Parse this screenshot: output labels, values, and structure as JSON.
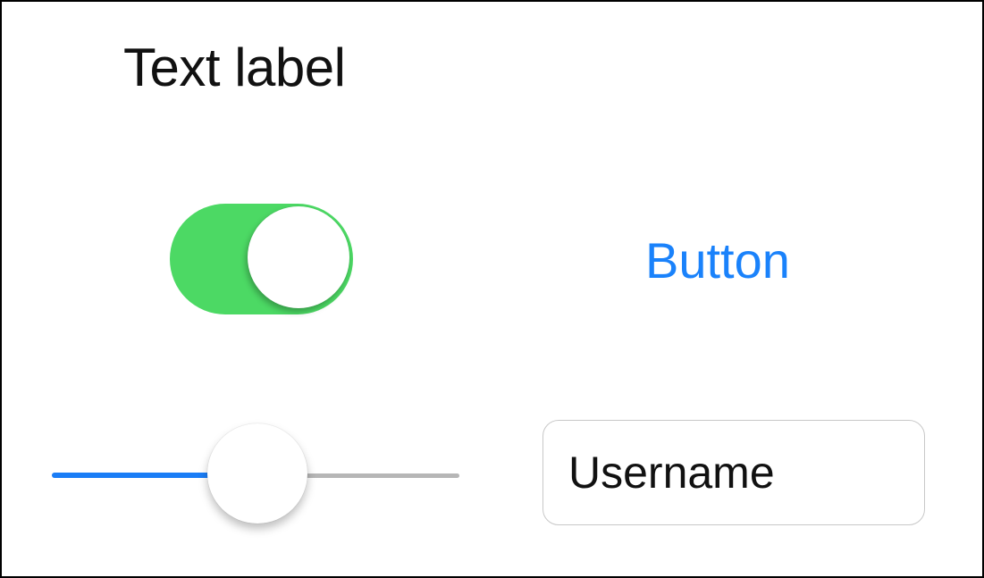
{
  "label": {
    "text": "Text label"
  },
  "toggle": {
    "state": "on",
    "on_color": "#4cd964"
  },
  "button": {
    "label": "Button",
    "color": "#1a82fb"
  },
  "slider": {
    "value": 0.5,
    "min_track_color": "#1a7df6",
    "max_track_color": "#b6b6b6"
  },
  "textfield": {
    "placeholder": "Username"
  }
}
